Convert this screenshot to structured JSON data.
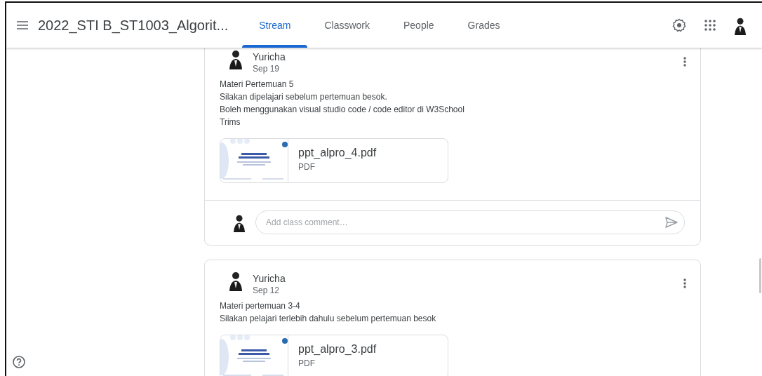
{
  "header": {
    "title": "2022_STI B_ST1003_Algorit...",
    "tabs": [
      {
        "label": "Stream",
        "selected": true
      },
      {
        "label": "Classwork",
        "selected": false
      },
      {
        "label": "People",
        "selected": false
      },
      {
        "label": "Grades",
        "selected": false
      }
    ]
  },
  "posts": [
    {
      "author": "Yuricha",
      "date": "Sep 19",
      "lines": [
        "Materi Pertemuan 5",
        "Silakan dipelajari sebelum pertemuan besok.",
        "Boleh menggunakan visual studio code / code editor di W3School",
        "Trims"
      ],
      "attachments": [
        {
          "name": "ppt_alpro_4.pdf",
          "type": "PDF"
        }
      ],
      "comment_placeholder": "Add class comment…"
    },
    {
      "author": "Yuricha",
      "date": "Sep 12",
      "lines": [
        "Materi pertemuan 3-4",
        "Silakan pelajari terlebih dahulu sebelum pertemuan besok"
      ],
      "attachments": [
        {
          "name": "ppt_alpro_3.pdf",
          "type": "PDF"
        }
      ]
    }
  ]
}
